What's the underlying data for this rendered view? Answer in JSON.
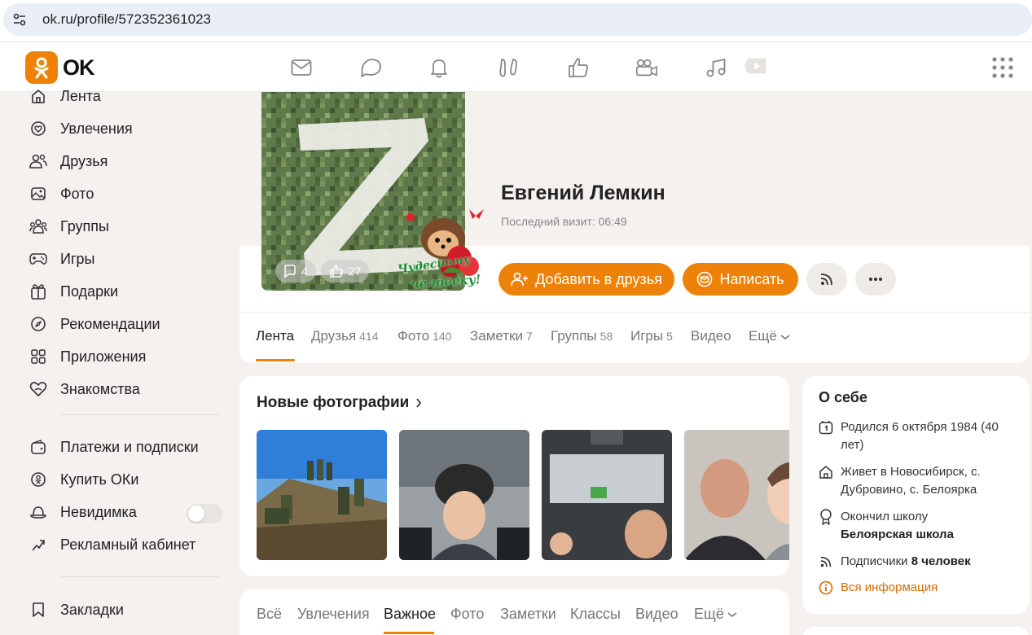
{
  "browser": {
    "url": "ok.ru/profile/572352361023"
  },
  "brand": {
    "name": "OK",
    "accent": "#ee8208"
  },
  "topnav": {
    "icons": [
      "mail-icon",
      "chat-icon",
      "bell-icon",
      "guests-icon",
      "like-icon",
      "video-camera-icon",
      "music-icon",
      "play-icon",
      "apps-grid-icon"
    ]
  },
  "sidebar": {
    "items": [
      {
        "label": "Лента",
        "icon": "home-icon"
      },
      {
        "label": "Увлечения",
        "icon": "hobby-icon"
      },
      {
        "label": "Друзья",
        "icon": "friends-icon"
      },
      {
        "label": "Фото",
        "icon": "photo-icon"
      },
      {
        "label": "Группы",
        "icon": "groups-icon"
      },
      {
        "label": "Игры",
        "icon": "gamepad-icon"
      },
      {
        "label": "Подарки",
        "icon": "gift-icon"
      },
      {
        "label": "Рекомендации",
        "icon": "compass-icon"
      },
      {
        "label": "Приложения",
        "icon": "apps-icon"
      },
      {
        "label": "Знакомства",
        "icon": "dating-icon"
      }
    ],
    "items2": [
      {
        "label": "Платежи и подписки",
        "icon": "wallet-icon"
      },
      {
        "label": "Купить ОКи",
        "icon": "coin-icon"
      },
      {
        "label": "Невидимка",
        "icon": "invisible-icon"
      },
      {
        "label": "Рекламный кабинет",
        "icon": "ads-icon"
      }
    ],
    "items3": [
      {
        "label": "Закладки",
        "icon": "bookmark-icon"
      }
    ]
  },
  "profile": {
    "name": "Евгений Лемкин",
    "last_visit": "Последний визит: 06:49",
    "avatar_comments": "4",
    "avatar_likes": "27",
    "sticker_text_1": "Чудесному",
    "sticker_text_2": "человеку!",
    "add_friend": "Добавить в друзья",
    "write": "Написать",
    "tabs": [
      {
        "label": "Лента",
        "count": ""
      },
      {
        "label": "Друзья",
        "count": "414"
      },
      {
        "label": "Фото",
        "count": "140"
      },
      {
        "label": "Заметки",
        "count": "7"
      },
      {
        "label": "Группы",
        "count": "58"
      },
      {
        "label": "Игры",
        "count": "5"
      },
      {
        "label": "Видео",
        "count": ""
      },
      {
        "label": "Ещё",
        "count": ""
      }
    ]
  },
  "photos": {
    "title": "Новые фотографии"
  },
  "about": {
    "title": "О себе",
    "born": "Родился 6 октября 1984 (40 лет)",
    "lives": "Живет в Новосибирск, с. Дубровино, с. Белоярка",
    "school_prefix": "Окончил школу",
    "school": "Белоярская школа",
    "subs_prefix": "Подписчики",
    "subs": "8 человек",
    "all_info": "Вся информация"
  },
  "feed_tabs": [
    "Всё",
    "Увлечения",
    "Важное",
    "Фото",
    "Заметки",
    "Классы",
    "Видео",
    "Ещё"
  ]
}
